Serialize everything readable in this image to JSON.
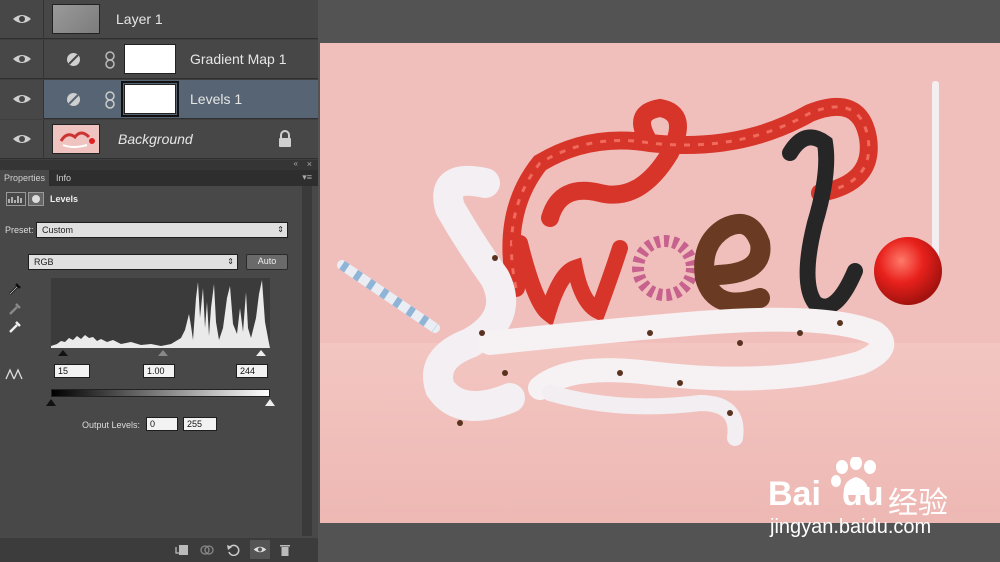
{
  "layers": [
    {
      "name": "Layer 1",
      "selected": false,
      "thumb": "gray-noise"
    },
    {
      "name": "Gradient Map 1",
      "selected": false,
      "thumb": "white-mask",
      "type": "adjustment"
    },
    {
      "name": "Levels 1",
      "selected": true,
      "thumb": "white-mask",
      "type": "adjustment"
    },
    {
      "name": "Background",
      "selected": false,
      "thumb": "image",
      "locked": true
    }
  ],
  "panel": {
    "tabs": [
      "Properties",
      "Info"
    ],
    "title": "Levels",
    "preset_label": "Preset:",
    "preset_value": "Custom",
    "channel_value": "RGB",
    "auto_label": "Auto",
    "input_black": "15",
    "input_gamma": "1.00",
    "input_white": "244",
    "output_label": "Output Levels:",
    "output_black": "0",
    "output_white": "255"
  },
  "canvas": {
    "artwork_title": "Sweet"
  },
  "watermark": {
    "brand": "Bai",
    "brand2": "du",
    "cn": "经验",
    "url": "jingyan.baidu.com"
  },
  "colors": {
    "selected_layer": "#566474",
    "canvas_bg": "#f1bfbb",
    "licorice_red": "#d8352a",
    "lollipop": "#e8211c"
  }
}
